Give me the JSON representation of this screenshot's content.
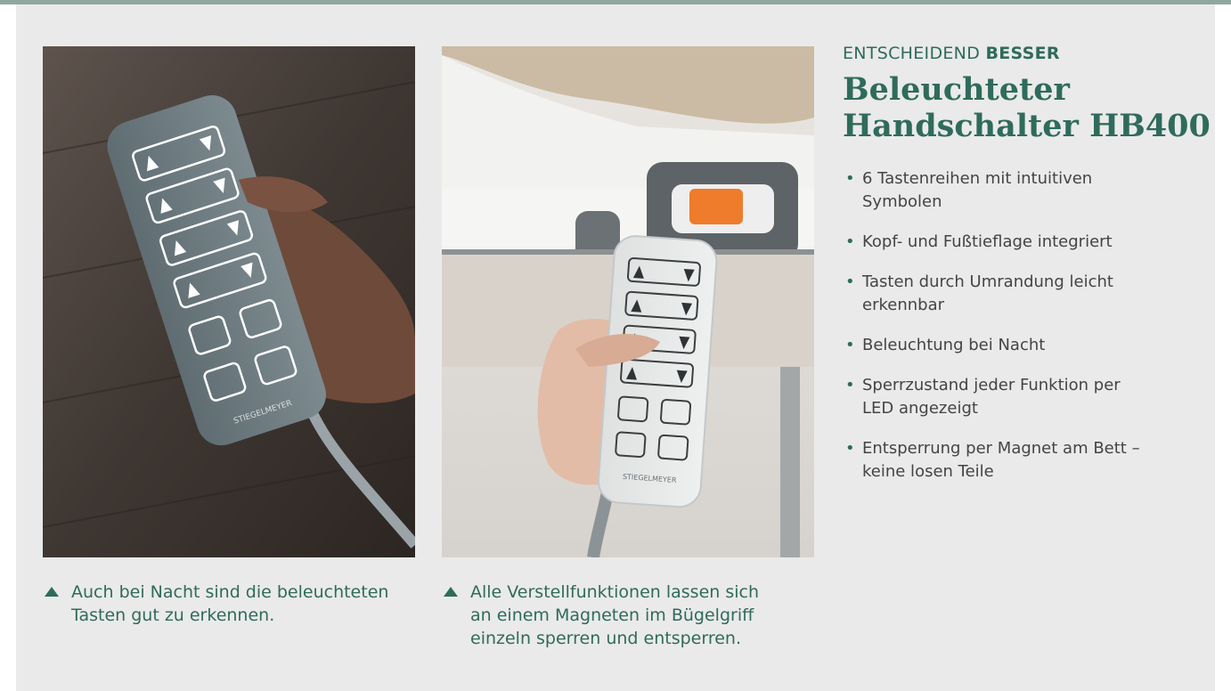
{
  "header": {
    "kicker_regular": "ENTSCHEIDEND",
    "kicker_bold": "BESSER",
    "title_line1": "Beleuchteter",
    "title_line2": "Handschalter HB400"
  },
  "features": [
    {
      "line1": "6 Tastenreihen mit intuitiven",
      "line2": "Symbolen"
    },
    {
      "line1": "Kopf- und Fußtieflage integriert",
      "line2": ""
    },
    {
      "line1": "Tasten durch Umrandung leicht",
      "line2": "erkennbar"
    },
    {
      "line1": "Beleuchtung bei Nacht",
      "line2": ""
    },
    {
      "line1": "Sperrzustand jeder Funktion per",
      "line2": "LED angezeigt"
    },
    {
      "line1": "Entsperrung per Magnet am Bett –",
      "line2": "keine losen Teile"
    }
  ],
  "photos": [
    {
      "caption_line1": "Auch bei Nacht sind die beleuchteten",
      "caption_line2": "Tasten gut zu erkennen.",
      "caption_line3": "",
      "device_label": "STIEGELMEYER"
    },
    {
      "caption_line1": "Alle Verstellfunktionen lassen sich",
      "caption_line2": "an einem Magneten im Bügelgriff",
      "caption_line3": "einzeln sperren und entsperren.",
      "device_label": "STIEGELMEYER"
    }
  ],
  "colors": {
    "accent": "#2f6b5b",
    "panel_bg": "#eaeaea",
    "top_rule": "#8fa89d",
    "body_text": "#444444"
  },
  "icons": {
    "caption_marker": "triangle-up-icon",
    "bullet_marker": "bullet-dot-icon"
  }
}
